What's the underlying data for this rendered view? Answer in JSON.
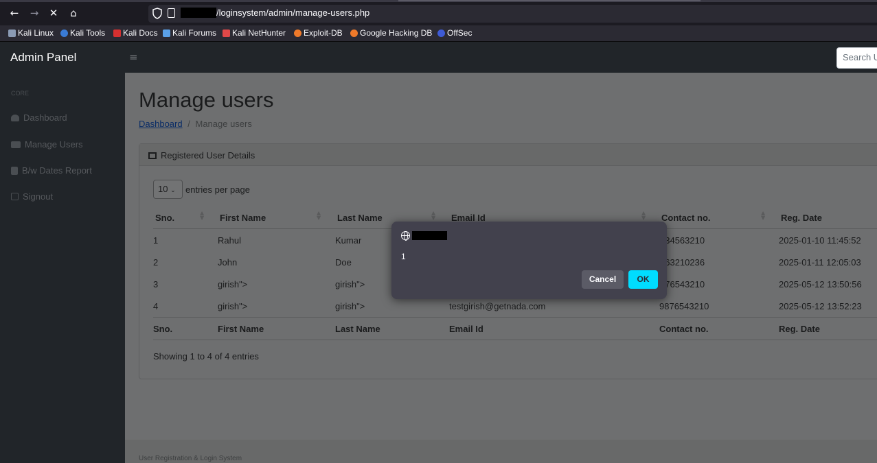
{
  "browser": {
    "url_path": "/loginsystem/admin/manage-users.php",
    "bookmarks": [
      "Kali Linux",
      "Kali Tools",
      "Kali Docs",
      "Kali Forums",
      "Kali NetHunter",
      "Exploit-DB",
      "Google Hacking DB",
      "OffSec"
    ]
  },
  "topnav": {
    "brand": "Admin Panel",
    "search_placeholder": "Search U"
  },
  "sidebar": {
    "heading": "CORE",
    "items": [
      {
        "label": "Dashboard",
        "icon": "dashboard-icon"
      },
      {
        "label": "Manage Users",
        "icon": "users-icon"
      },
      {
        "label": "B/w Dates Report",
        "icon": "calendar-icon"
      },
      {
        "label": "Signout",
        "icon": "signout-icon"
      }
    ]
  },
  "main": {
    "title": "Manage users",
    "breadcrumb": {
      "link": "Dashboard",
      "separator": "/",
      "current": "Manage users"
    },
    "card": {
      "title": "Registered User Details",
      "entries_value": "10",
      "entries_label": "entries per page",
      "columns": [
        "Sno.",
        "First Name",
        "Last Name",
        "Email Id",
        "Contact no.",
        "Reg. Date"
      ],
      "rows": [
        [
          "1",
          "Rahul",
          "Kumar",
          "",
          "234563210",
          "2025-01-10 11:45:52"
        ],
        [
          "2",
          "John",
          "Doe",
          "",
          "563210236",
          "2025-01-11 12:05:03"
        ],
        [
          "3",
          "girish\">",
          "girish\">",
          "",
          "876543210",
          "2025-05-12 13:50:56"
        ],
        [
          "4",
          "girish\">",
          "girish\">",
          "testgirish@getnada.com",
          "9876543210",
          "2025-05-12 13:52:23"
        ]
      ],
      "showing": "Showing 1 to 4 of 4 entries"
    },
    "footer": "User Registration & Login System"
  },
  "dialog": {
    "message": "1",
    "cancel_label": "Cancel",
    "ok_label": "OK"
  },
  "colors": {
    "accent": "#00ddff",
    "sidebar_bg": "#212529",
    "overlay_bg": "#6e6f70"
  }
}
